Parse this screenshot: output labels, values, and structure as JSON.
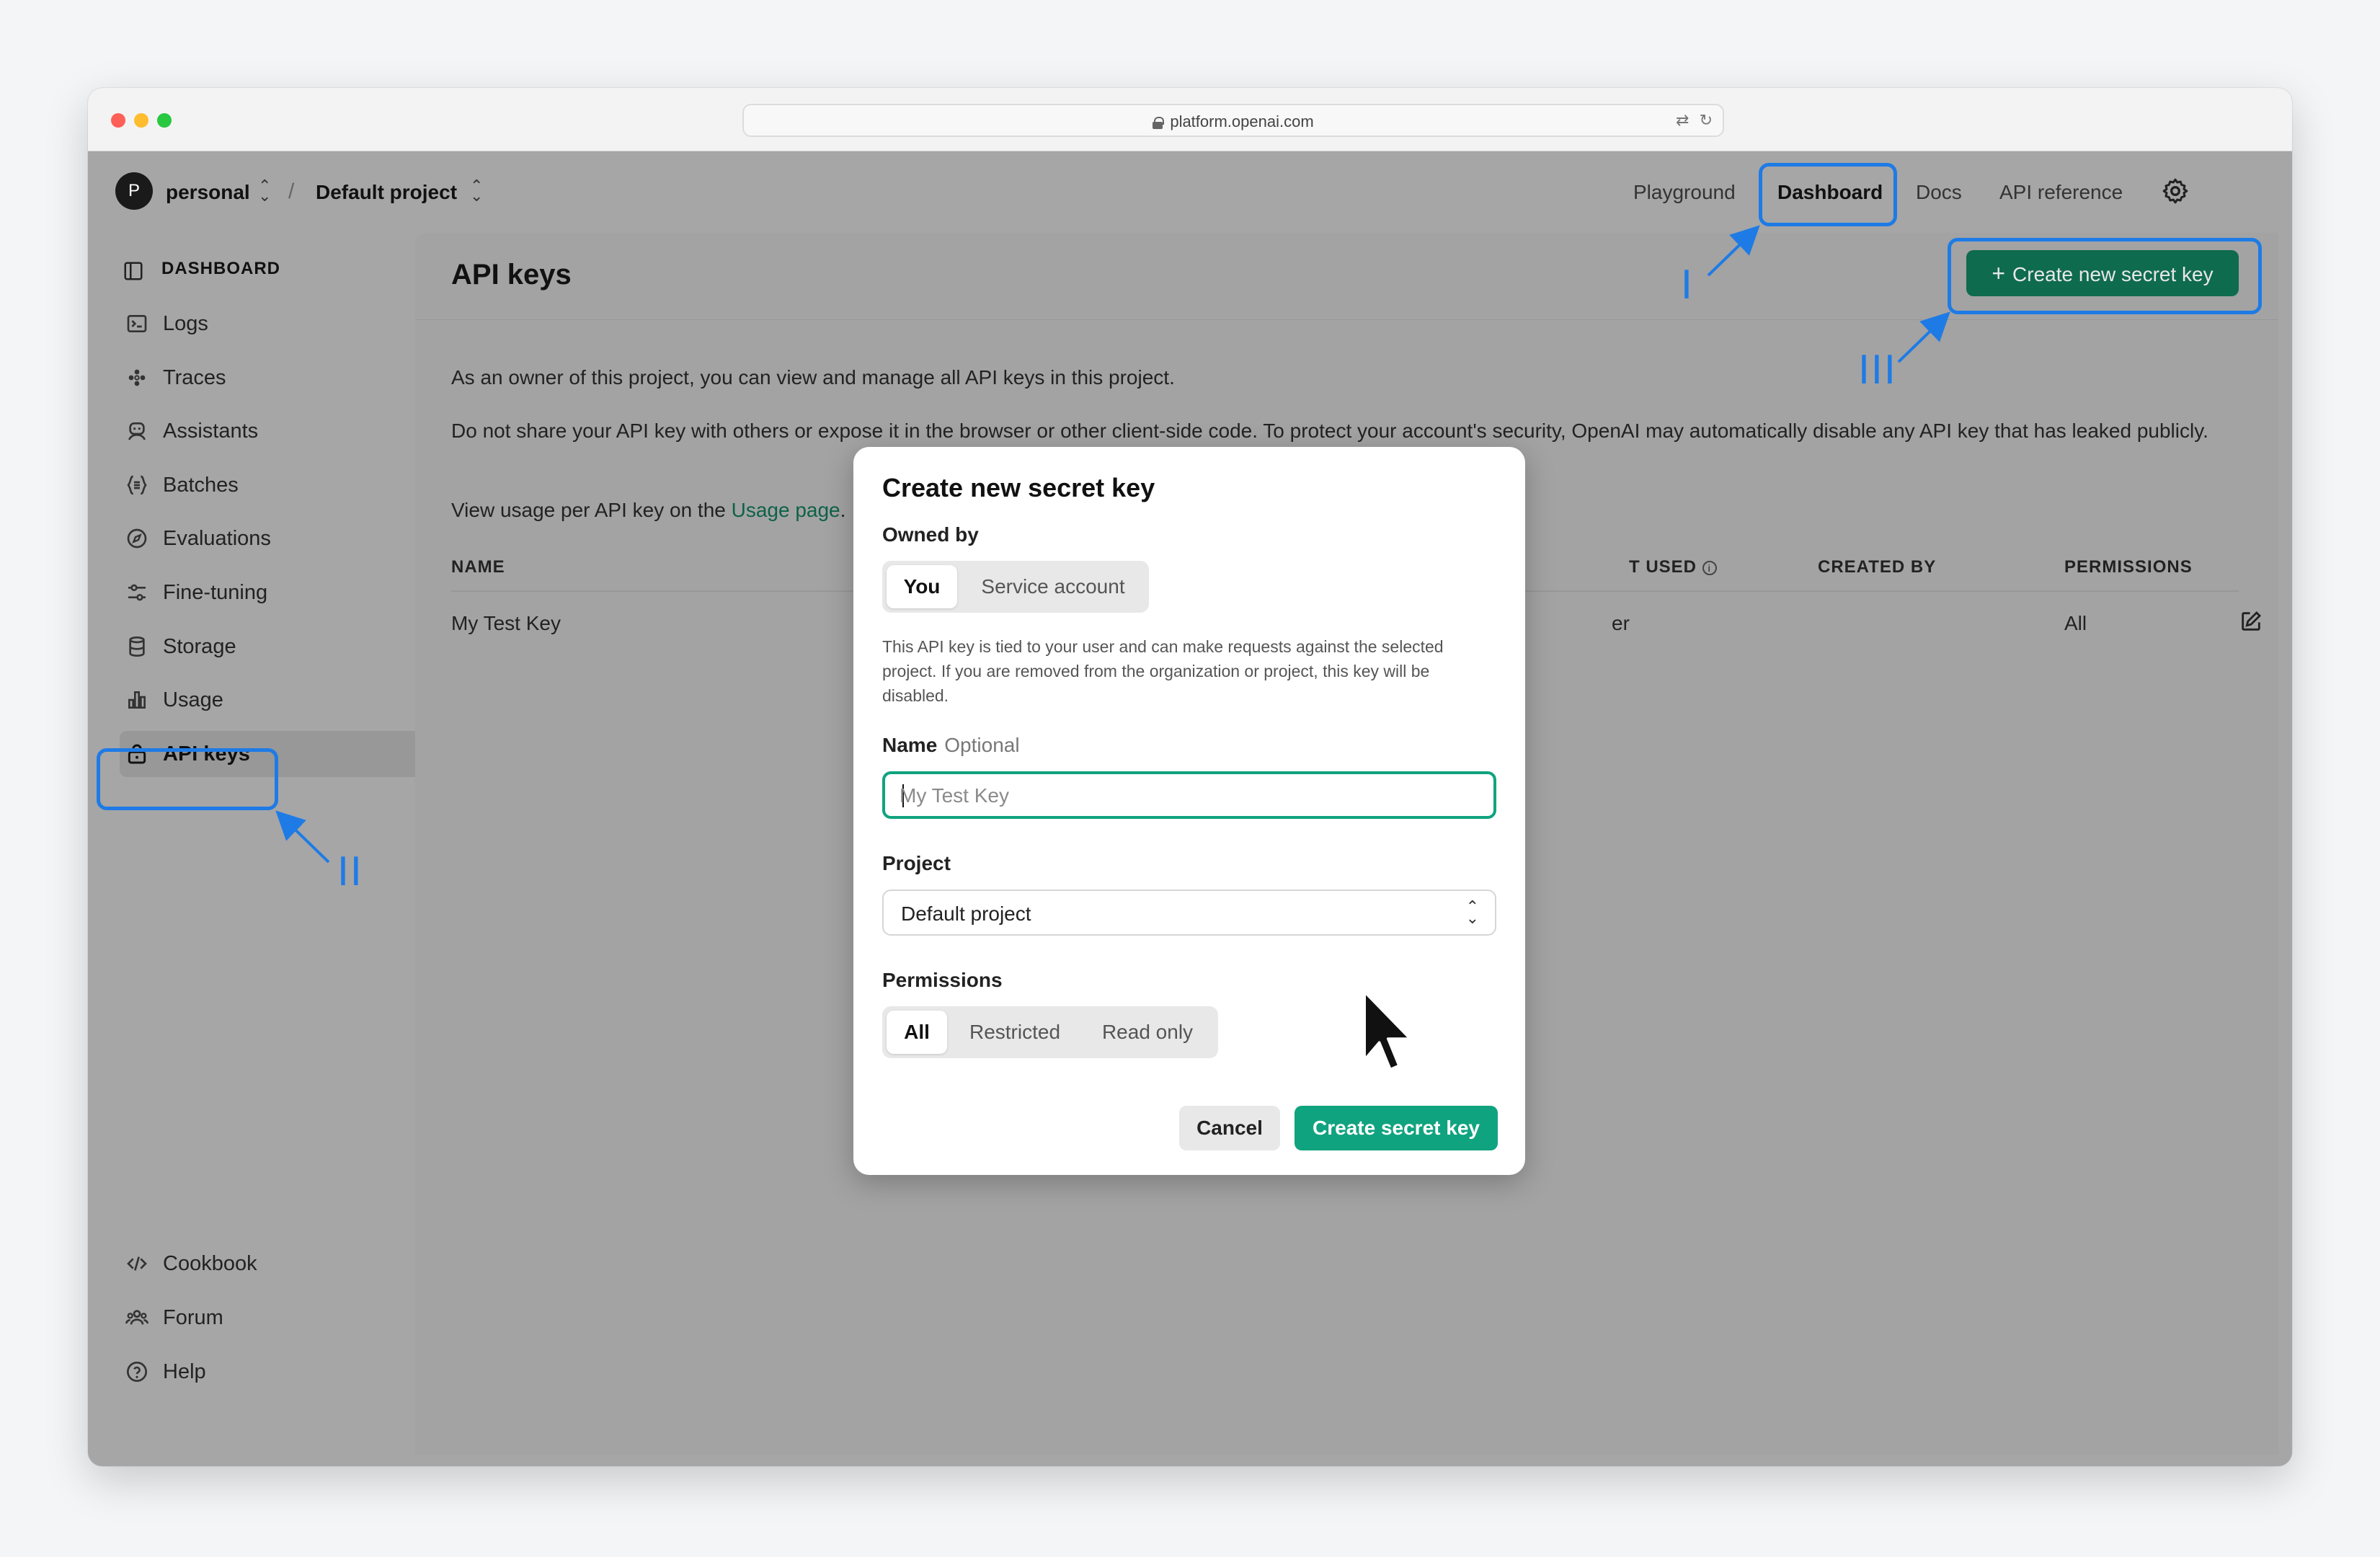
{
  "browser": {
    "url": "platform.openai.com"
  },
  "topbar": {
    "workspace_initial": "P",
    "workspace": "personal",
    "separator": "/",
    "project": "Default project",
    "nav": [
      "Playground",
      "Dashboard",
      "Docs",
      "API reference"
    ]
  },
  "sidebar": {
    "heading": "DASHBOARD",
    "items": [
      {
        "label": "Logs",
        "icon": "terminal-icon"
      },
      {
        "label": "Traces",
        "icon": "traces-icon"
      },
      {
        "label": "Assistants",
        "icon": "assistant-icon"
      },
      {
        "label": "Batches",
        "icon": "batches-icon"
      },
      {
        "label": "Evaluations",
        "icon": "evaluations-icon"
      },
      {
        "label": "Fine-tuning",
        "icon": "sliders-icon"
      },
      {
        "label": "Storage",
        "icon": "database-icon"
      },
      {
        "label": "Usage",
        "icon": "bar-chart-icon"
      },
      {
        "label": "API keys",
        "icon": "lock-icon",
        "active": true
      }
    ],
    "footer": [
      {
        "label": "Cookbook",
        "icon": "code-icon"
      },
      {
        "label": "Forum",
        "icon": "people-icon"
      },
      {
        "label": "Help",
        "icon": "help-icon"
      }
    ]
  },
  "main": {
    "title": "API keys",
    "create_button": "Create new secret key",
    "para1": "As an owner of this project, you can view and manage all API keys in this project.",
    "para2": "Do not share your API key with others or expose it in the browser or other client-side code. To protect your account's security, OpenAI may automatically disable any API key that has leaked publicly.",
    "para3_prefix": "View usage per API key on the",
    "para3_link": "Usage page",
    "para3_suffix": ".",
    "table": {
      "headers": [
        "NAME",
        "T USED",
        "CREATED BY",
        "PERMISSIONS"
      ],
      "rows": [
        {
          "name": "My Test Key",
          "last_used_fragment": "er",
          "created_by": "",
          "permissions": "All"
        }
      ]
    }
  },
  "modal": {
    "title": "Create new secret key",
    "owned_by_label": "Owned by",
    "owned_by_options": [
      "You",
      "Service account"
    ],
    "owned_by_selected": "You",
    "description": "This API key is tied to your user and can make requests against the selected project. If you are removed from the organization or project, this key will be disabled.",
    "name_label": "Name",
    "name_optional": "Optional",
    "name_placeholder": "My Test Key",
    "project_label": "Project",
    "project_value": "Default project",
    "permissions_label": "Permissions",
    "permissions_options": [
      "All",
      "Restricted",
      "Read only"
    ],
    "permissions_selected": "All",
    "cancel": "Cancel",
    "submit": "Create secret key"
  },
  "annotations": {
    "step1": "I",
    "step2": "II",
    "step3": "III",
    "color": "#1e7be6"
  }
}
